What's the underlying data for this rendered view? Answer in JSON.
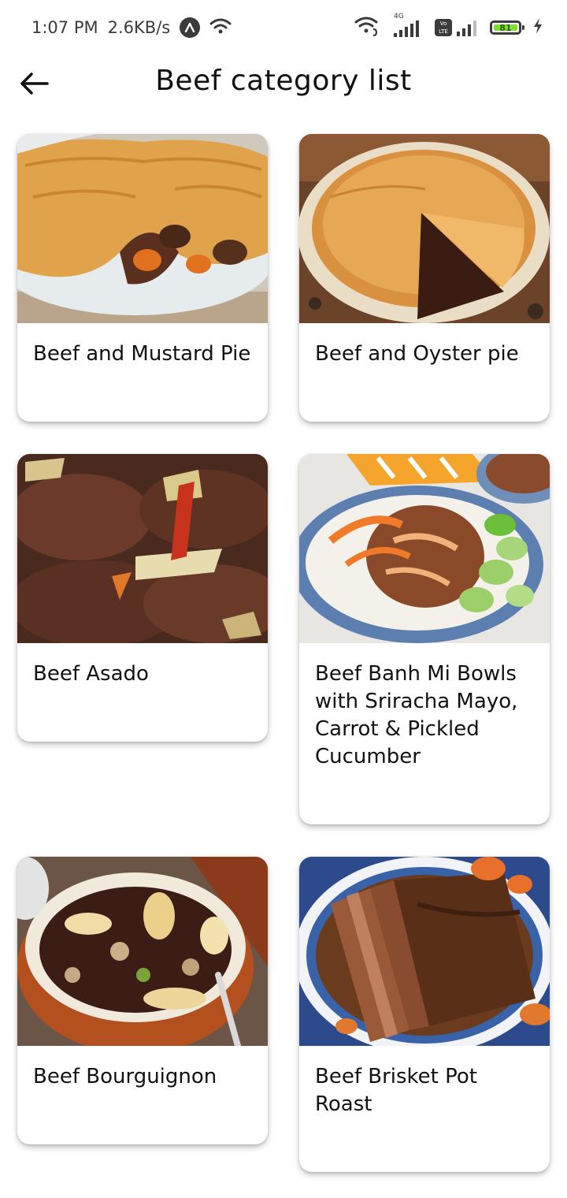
{
  "status_bar": {
    "time": "1:07 PM",
    "speed": "2.6KB/s",
    "network_label": "4G",
    "volte_label": "Vo LTE",
    "battery_level": "81"
  },
  "header": {
    "title": "Beef category list"
  },
  "recipes": [
    {
      "title": "Beef and Mustard Pie",
      "image": "beef-mustard-pie-photo"
    },
    {
      "title": "Beef and Oyster pie",
      "image": "beef-oyster-pie-photo"
    },
    {
      "title": "Beef Asado",
      "image": "beef-asado-photo"
    },
    {
      "title": "Beef Banh Mi Bowls with Sriracha Mayo, Carrot & Pickled Cucumber",
      "image": "beef-banh-mi-bowl-photo"
    },
    {
      "title": "Beef Bourguignon",
      "image": "beef-bourguignon-photo"
    },
    {
      "title": "Beef Brisket Pot Roast",
      "image": "beef-brisket-photo"
    }
  ]
}
